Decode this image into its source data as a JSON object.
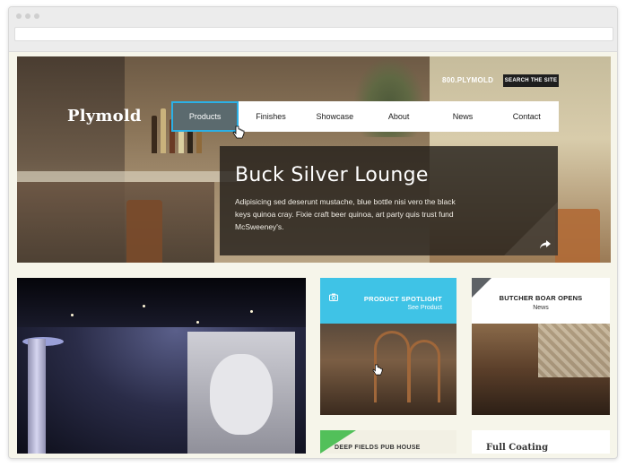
{
  "header": {
    "logo": "Plymold",
    "phone": "800.PLYMOLD",
    "search_label": "SEARCH THE SITE"
  },
  "nav": {
    "items": [
      {
        "label": "Products",
        "active": true
      },
      {
        "label": "Finishes"
      },
      {
        "label": "Showcase"
      },
      {
        "label": "About"
      },
      {
        "label": "News"
      },
      {
        "label": "Contact"
      }
    ]
  },
  "hero": {
    "title": "Buck Silver Lounge",
    "body": "Adipisicing sed deserunt mustache, blue bottle nisi vero the black keys quinoa cray. Fixie craft beer quinoa, art party quis trust fund McSweeney's."
  },
  "spotlight": {
    "title": "PRODUCT SPOTLIGHT",
    "link": "See Product",
    "color": "#3fc3e6"
  },
  "news_tile": {
    "title": "BUTCHER BOAR OPENS",
    "subtitle": "News"
  },
  "teasers": {
    "green_text": "DEEP FIELDS PUB HOUSE",
    "white_text": "Full Coating"
  },
  "colors": {
    "accent_blue": "#2bb0e6",
    "accent_green": "#52c05a",
    "page_bg": "#f6f5ea"
  }
}
